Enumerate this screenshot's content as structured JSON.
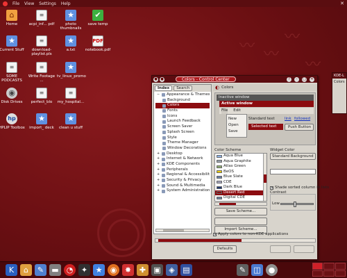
{
  "menubar": {
    "items": [
      "File",
      "View",
      "Settings",
      "Help"
    ]
  },
  "desktop_icons": [
    {
      "label": "Home",
      "icon": "home",
      "glyph": "⌂"
    },
    {
      "label": "acpi_inf... pdf",
      "icon": "doc",
      "glyph": "≡"
    },
    {
      "label": "photo thumbnails",
      "icon": "star",
      "glyph": "★"
    },
    {
      "label": "save temp",
      "icon": "green",
      "glyph": "✔"
    },
    {
      "label": "Current Stuff",
      "icon": "star",
      "glyph": "★"
    },
    {
      "label": "download-playlist.pls",
      "icon": "doc",
      "glyph": "≡"
    },
    {
      "label": "a.txt",
      "icon": "star",
      "glyph": "★"
    },
    {
      "label": "notebook.pdf",
      "icon": "pdf",
      "glyph": "PDF"
    },
    {
      "label": "SOME PODCASTS",
      "icon": "doc",
      "glyph": "≡"
    },
    {
      "label": "Write Footage ...",
      "icon": "doc",
      "glyph": "≡"
    },
    {
      "label": "tv_linux_promo",
      "icon": "star",
      "glyph": "★"
    },
    {
      "label": "Disk Drives",
      "icon": "cd",
      "glyph": "◉"
    },
    {
      "label": "perfect_blo",
      "icon": "doc",
      "glyph": "≡"
    },
    {
      "label": "my_hospital...",
      "icon": "doc",
      "glyph": "≡"
    },
    {
      "label": "HPLIP Toolbox",
      "icon": "hp",
      "glyph": "hp"
    },
    {
      "label": "import_ deck",
      "icon": "star",
      "glyph": "★"
    },
    {
      "label": "clean u stuff",
      "icon": "star",
      "glyph": "★"
    }
  ],
  "window": {
    "title": "Colors - Control Center",
    "side_tabs": [
      "Index",
      "Search"
    ],
    "tree": [
      {
        "label": "Appearance & Themes",
        "level": 1,
        "exp": "−"
      },
      {
        "label": "Background",
        "level": 2
      },
      {
        "label": "Colors",
        "level": 2,
        "selected": true
      },
      {
        "label": "Fonts",
        "level": 2
      },
      {
        "label": "Icons",
        "level": 2
      },
      {
        "label": "Launch Feedback",
        "level": 2
      },
      {
        "label": "Screen Saver",
        "level": 2
      },
      {
        "label": "Splash Screen",
        "level": 2
      },
      {
        "label": "Style",
        "level": 2
      },
      {
        "label": "Theme Manager",
        "level": 2
      },
      {
        "label": "Window Decorations",
        "level": 2
      },
      {
        "label": "Desktop",
        "level": 1,
        "exp": "+"
      },
      {
        "label": "Internet & Network",
        "level": 1,
        "exp": "+"
      },
      {
        "label": "KDE Components",
        "level": 1,
        "exp": "+"
      },
      {
        "label": "Peripherals",
        "level": 1,
        "exp": "+"
      },
      {
        "label": "Regional & Accessibility",
        "level": 1,
        "exp": "+"
      },
      {
        "label": "Security & Privacy",
        "level": 1,
        "exp": "+"
      },
      {
        "label": "Sound & Multimedia",
        "level": 1,
        "exp": "+"
      },
      {
        "label": "System Administration",
        "level": 1,
        "exp": "+"
      }
    ],
    "main_header": "Colors",
    "preview": {
      "inactive": "Inactive window",
      "active": "Active window",
      "menu": [
        "File",
        "Edit"
      ],
      "popup": [
        "New",
        "Open",
        "Save"
      ],
      "standard_text": "Standard text",
      "link": "link",
      "followed": "followed",
      "selected_text": "Selected text",
      "push_button": "Push Button"
    },
    "color_scheme_label": "Color Scheme",
    "schemes": [
      {
        "label": "Aqua Blue",
        "color": "#8fb4e8"
      },
      {
        "label": "Aqua Graphite",
        "color": "#9aa4b0"
      },
      {
        "label": "Atlas Green",
        "color": "#8fb070"
      },
      {
        "label": "BeOS",
        "color": "#f0d000"
      },
      {
        "label": "Blue Slate",
        "color": "#6a80a8"
      },
      {
        "label": "CDE",
        "color": "#a8a8c0"
      },
      {
        "label": "Dark Blue",
        "color": "#203870"
      },
      {
        "label": "Desert Red",
        "color": "#8c0c10",
        "selected": true
      },
      {
        "label": "Digital CDE",
        "color": "#7080a0"
      }
    ],
    "save_scheme": "Save Scheme...",
    "import_scheme": "Import Scheme...",
    "widget_color_label": "Widget Color",
    "widget_color_value": "Standard Background",
    "shade_label": "Shade sorted column in lists",
    "contrast_label": "Contrast",
    "low_label": "Low",
    "contrast_level": 0.42,
    "apply_label": "Apply colors to non-KDE applications",
    "defaults_button": "Defaults"
  },
  "right_window": {
    "title": "KDE-L",
    "label": "Colors"
  },
  "colors": {
    "accent": "#8c0c10",
    "desktop": "#6e1014",
    "panel": "#4a080b"
  }
}
